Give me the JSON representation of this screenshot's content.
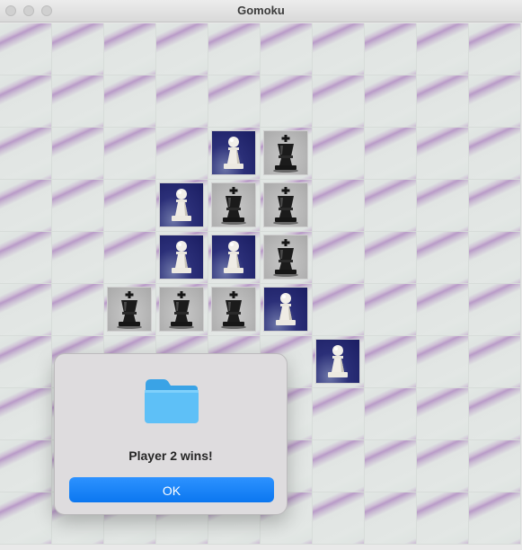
{
  "window": {
    "title": "Gomoku"
  },
  "board": {
    "cols": 10,
    "rows": 10,
    "pieces": [
      {
        "col": 4,
        "row": 2,
        "color": "white"
      },
      {
        "col": 5,
        "row": 2,
        "color": "black"
      },
      {
        "col": 3,
        "row": 3,
        "color": "white"
      },
      {
        "col": 4,
        "row": 3,
        "color": "black"
      },
      {
        "col": 5,
        "row": 3,
        "color": "black"
      },
      {
        "col": 3,
        "row": 4,
        "color": "white"
      },
      {
        "col": 4,
        "row": 4,
        "color": "white"
      },
      {
        "col": 5,
        "row": 4,
        "color": "black"
      },
      {
        "col": 2,
        "row": 5,
        "color": "black"
      },
      {
        "col": 3,
        "row": 5,
        "color": "black"
      },
      {
        "col": 4,
        "row": 5,
        "color": "black"
      },
      {
        "col": 5,
        "row": 5,
        "color": "white"
      },
      {
        "col": 6,
        "row": 6,
        "color": "white"
      }
    ]
  },
  "dialog": {
    "message": "Player 2 wins!",
    "ok_label": "OK",
    "icon": "folder-icon"
  },
  "colors": {
    "accent": "#0a7aff",
    "white_piece_bg": "#232a7a",
    "black_piece_bg": "#b5b5b5"
  }
}
